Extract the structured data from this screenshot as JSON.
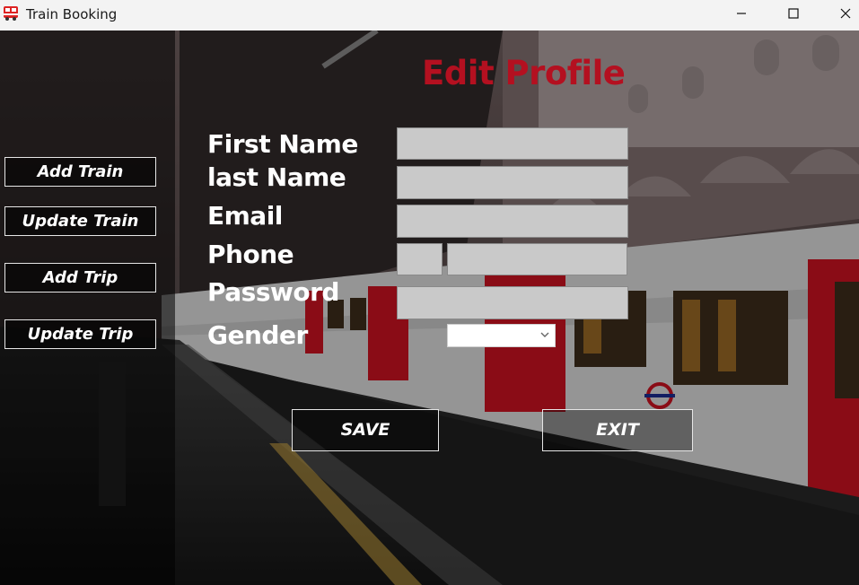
{
  "window": {
    "title": "Train Booking",
    "icon": "train-icon",
    "controls": {
      "minimize": "minimize-icon",
      "maximize": "maximize-icon",
      "close": "close-icon"
    }
  },
  "page": {
    "title": "Edit Profile",
    "title_color": "#b41020"
  },
  "sidebar": {
    "items": [
      {
        "label": "Add Train"
      },
      {
        "label": "Update Train"
      },
      {
        "label": "Add Trip"
      },
      {
        "label": "Update Trip"
      }
    ]
  },
  "form": {
    "first_name": {
      "label": "First Name",
      "value": ""
    },
    "last_name": {
      "label": "last Name",
      "value": ""
    },
    "email": {
      "label": "Email",
      "value": ""
    },
    "phone": {
      "label": "Phone",
      "code": "",
      "value": ""
    },
    "password": {
      "label": "Password",
      "value": ""
    },
    "gender": {
      "label": "Gender",
      "selected": ""
    }
  },
  "actions": {
    "save": "SAVE",
    "exit": "EXIT"
  }
}
